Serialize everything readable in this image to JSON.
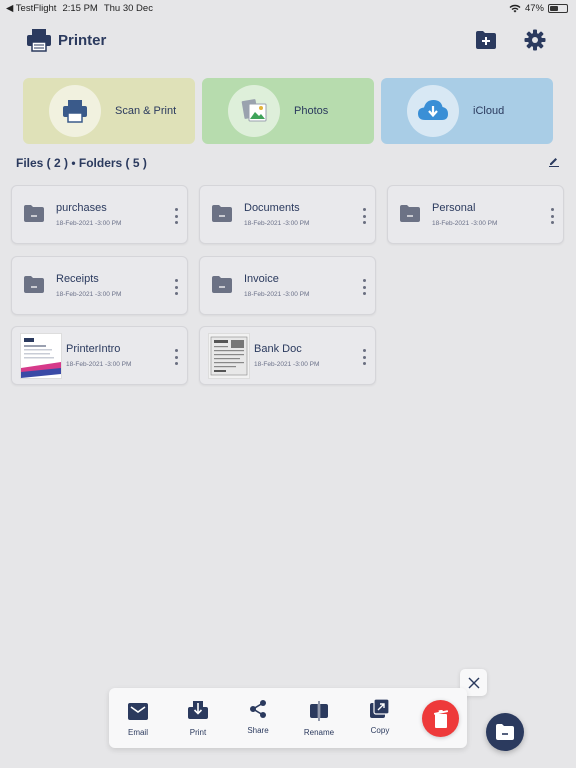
{
  "status": {
    "back_app": "TestFlight",
    "time": "2:15 PM",
    "date": "Thu 30 Dec",
    "battery": "47%",
    "battery_level": 0.47
  },
  "header": {
    "title": "Printer",
    "add_folder_icon": "folder-plus-icon",
    "settings_icon": "gear-icon"
  },
  "categories": [
    {
      "label": "Scan & Print",
      "icon": "printer-icon",
      "color": "#dfe1b8"
    },
    {
      "label": "Photos",
      "icon": "photos-icon",
      "color": "#b7dcae"
    },
    {
      "label": "iCloud",
      "icon": "cloud-download-icon",
      "color": "#a9cde6"
    }
  ],
  "section": {
    "title": "Files ( 2 ) • Folders ( 5 )",
    "edit_icon": "edit-icon"
  },
  "items": [
    {
      "name": "purchases",
      "date": "18-Feb-2021 -3:00 PM",
      "kind": "folder"
    },
    {
      "name": "Documents",
      "date": "18-Feb-2021 -3:00 PM",
      "kind": "folder"
    },
    {
      "name": "Personal",
      "date": "18-Feb-2021 -3:00 PM",
      "kind": "folder"
    },
    {
      "name": "Receipts",
      "date": "18-Feb-2021 -3:00 PM",
      "kind": "folder"
    },
    {
      "name": "Invoice",
      "date": "18-Feb-2021 -3:00 PM",
      "kind": "folder"
    },
    {
      "name": "PrinterIntro",
      "date": "18-Feb-2021 -3:00 PM",
      "kind": "file"
    },
    {
      "name": "Bank Doc",
      "date": "18-Feb-2021 -3:00 PM",
      "kind": "file"
    }
  ],
  "actions": [
    {
      "label": "Email",
      "icon": "email-icon"
    },
    {
      "label": "Print",
      "icon": "print-icon"
    },
    {
      "label": "Share",
      "icon": "share-icon"
    },
    {
      "label": "Rename",
      "icon": "rename-icon"
    },
    {
      "label": "Copy",
      "icon": "copy-icon"
    }
  ],
  "delete_icon": "trash-icon",
  "close_icon": "close-icon",
  "fab_icon": "folder-menu-icon",
  "colors": {
    "primary": "#2b3a5e",
    "delete": "#ee3a3a",
    "background": "#e6e6e8"
  }
}
